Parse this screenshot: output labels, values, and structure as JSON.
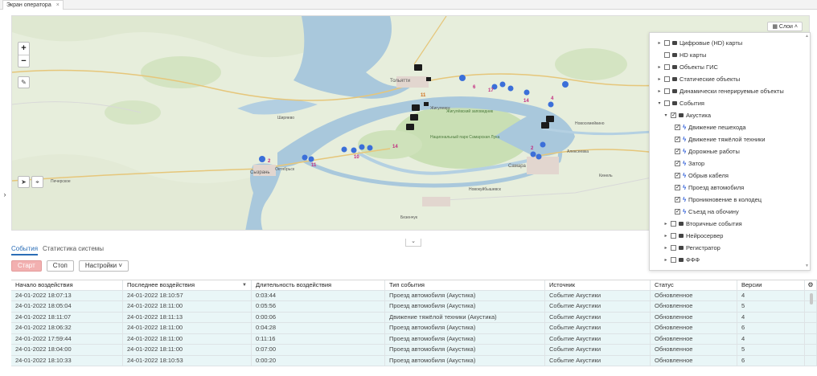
{
  "window": {
    "tab_title": "Экран оператора",
    "tab_close": "×"
  },
  "map": {
    "zoom_in": "+",
    "zoom_out": "−",
    "layers_button": "Слои",
    "places": {
      "tolyatti": "Тольятти",
      "samara": "Самара",
      "syzran": "Сызрань",
      "novokuybyshevsk": "Новокуйбышевск",
      "zhigulevsk": "Жигулевск",
      "park": "Национальный парк Самарская Лука",
      "reserve": "Жигулёвский заповедник",
      "shiryaevo": "Ширяево",
      "oktyabrsk": "Октябрьск",
      "alekseevka": "Алексеевка",
      "bezenchuk": "Безенчук",
      "novosemeykino": "Новосемейкино",
      "kinel": "Кинель",
      "pechersk": "Печерское"
    },
    "markers": [
      {
        "label": "2"
      },
      {
        "label": "11"
      },
      {
        "label": "6"
      },
      {
        "label": "17"
      },
      {
        "label": "14"
      },
      {
        "label": "14"
      },
      {
        "label": "10"
      },
      {
        "label": "11"
      },
      {
        "label": "4"
      },
      {
        "label": "2"
      }
    ]
  },
  "layers": [
    {
      "label": "Цифровые (HD) карты",
      "level": 0,
      "arrow": "▸",
      "checked": false,
      "bolt": false
    },
    {
      "label": "HD карты",
      "level": 0,
      "arrow": "",
      "checked": false,
      "bolt": false
    },
    {
      "label": "Объекты ГИС",
      "level": 0,
      "arrow": "▸",
      "checked": false,
      "bolt": false
    },
    {
      "label": "Статические объекты",
      "level": 0,
      "arrow": "▸",
      "checked": false,
      "bolt": false
    },
    {
      "label": "Динамически генерируемые объекты",
      "level": 0,
      "arrow": "▸",
      "checked": false,
      "bolt": false
    },
    {
      "label": "События",
      "level": 0,
      "arrow": "▾",
      "checked": false,
      "bolt": false
    },
    {
      "label": "Акустика",
      "level": 1,
      "arrow": "▾",
      "checked": true,
      "bolt": false
    },
    {
      "label": "Движение пешехода",
      "level": 2,
      "arrow": "",
      "checked": true,
      "bolt": true
    },
    {
      "label": "Движение тяжёлой техники",
      "level": 2,
      "arrow": "",
      "checked": true,
      "bolt": true
    },
    {
      "label": "Дорожные работы",
      "level": 2,
      "arrow": "",
      "checked": true,
      "bolt": true
    },
    {
      "label": "Затор",
      "level": 2,
      "arrow": "",
      "checked": true,
      "bolt": true
    },
    {
      "label": "Обрыв кабеля",
      "level": 2,
      "arrow": "",
      "checked": true,
      "bolt": true
    },
    {
      "label": "Проезд автомобиля",
      "level": 2,
      "arrow": "",
      "checked": true,
      "bolt": true
    },
    {
      "label": "Проникновение в колодец",
      "level": 2,
      "arrow": "",
      "checked": true,
      "bolt": true
    },
    {
      "label": "Съезд на обочину",
      "level": 2,
      "arrow": "",
      "checked": true,
      "bolt": true
    },
    {
      "label": "Вторичные события",
      "level": 1,
      "arrow": "▸",
      "checked": false,
      "bolt": false
    },
    {
      "label": "Нейросервер",
      "level": 1,
      "arrow": "▸",
      "checked": false,
      "bolt": false
    },
    {
      "label": "Регистратор",
      "level": 1,
      "arrow": "▸",
      "checked": false,
      "bolt": false
    },
    {
      "label": "ФФФ",
      "level": 1,
      "arrow": "▸",
      "checked": false,
      "bolt": false
    }
  ],
  "bottom": {
    "tabs": [
      "События",
      "Статистика системы"
    ],
    "buttons": {
      "start": "Старт",
      "stop": "Стоп",
      "settings": "Настройки"
    }
  },
  "table": {
    "columns": [
      "Начало воздействия",
      "Последнее воздействия",
      "Длительность воздействия",
      "Тип события",
      "Источник",
      "Статус",
      "Версии"
    ],
    "rows": [
      [
        "24-01-2022 18:07:13",
        "24-01-2022 18:10:57",
        "0:03:44",
        "Проезд автомобиля (Акустика)",
        "Событие Акустики",
        "Обновленное",
        "4"
      ],
      [
        "24-01-2022 18:05:04",
        "24-01-2022 18:11:00",
        "0:05:56",
        "Проезд автомобиля (Акустика)",
        "Событие Акустики",
        "Обновленное",
        "5"
      ],
      [
        "24-01-2022 18:11:07",
        "24-01-2022 18:11:13",
        "0:00:06",
        "Движение тяжёлой техники (Акустика)",
        "Событие Акустики",
        "Обновленное",
        "4"
      ],
      [
        "24-01-2022 18:06:32",
        "24-01-2022 18:11:00",
        "0:04:28",
        "Проезд автомобиля (Акустика)",
        "Событие Акустики",
        "Обновленное",
        "6"
      ],
      [
        "24-01-2022 17:59:44",
        "24-01-2022 18:11:00",
        "0:11:16",
        "Проезд автомобиля (Акустика)",
        "Событие Акустики",
        "Обновленное",
        "4"
      ],
      [
        "24-01-2022 18:04:00",
        "24-01-2022 18:11:00",
        "0:07:00",
        "Проезд автомобиля (Акустика)",
        "Событие Акустики",
        "Обновленное",
        "5"
      ],
      [
        "24-01-2022 18:10:33",
        "24-01-2022 18:10:53",
        "0:00:20",
        "Проезд автомобиля (Акустика)",
        "Событие Акустики",
        "Обновленное",
        "6"
      ]
    ]
  },
  "colors": {
    "accent": "#2a6db7",
    "row_bg": "#e9f6f7",
    "water": "#a9c8dc",
    "forest": "#c9dfb4",
    "start_button": "#f2b0b0"
  }
}
